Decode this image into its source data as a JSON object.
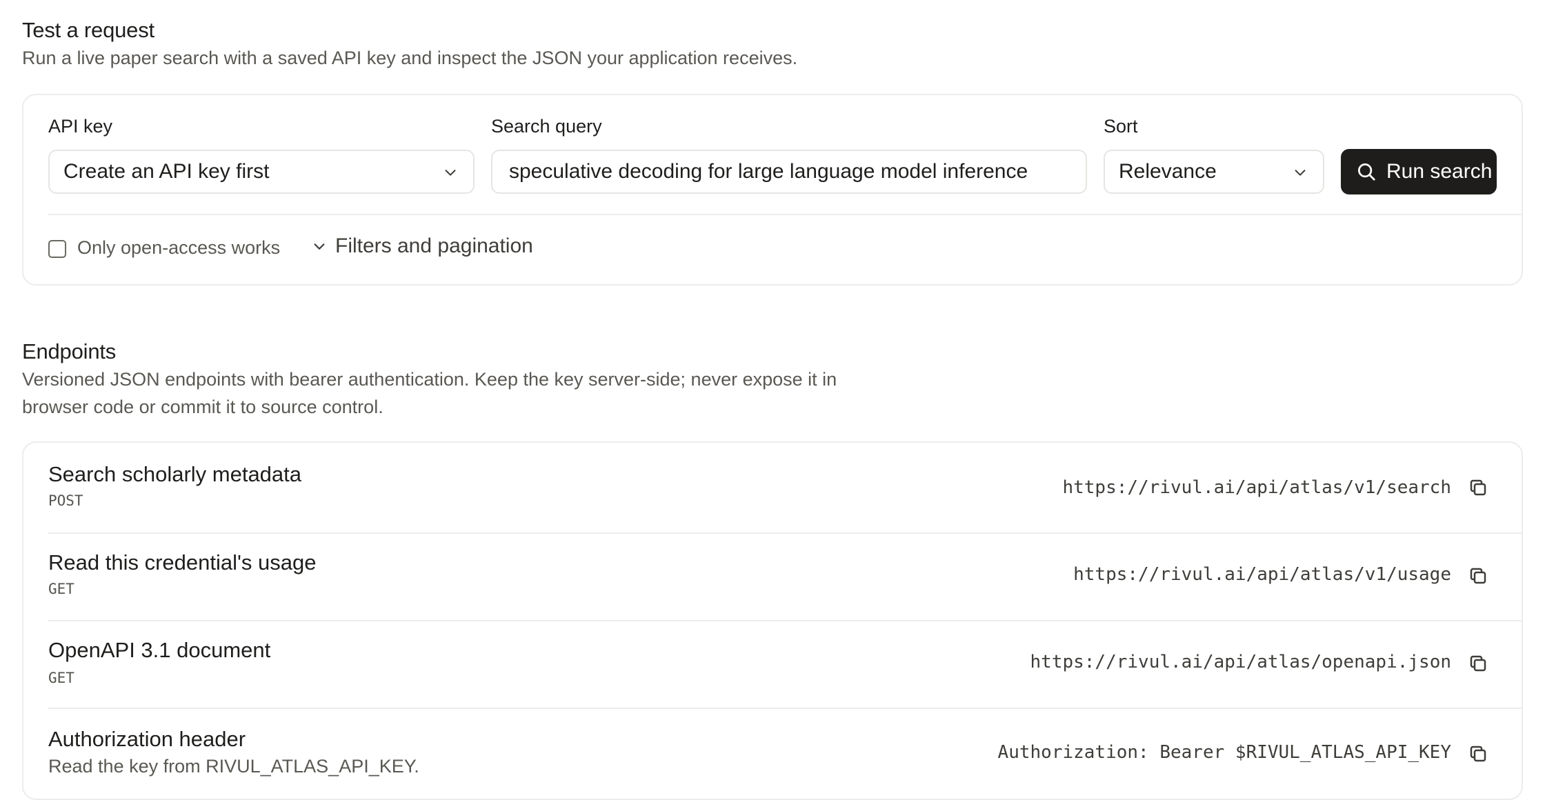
{
  "test_section": {
    "title": "Test a request",
    "description": "Run a live paper search with a saved API key and inspect the JSON your application receives.",
    "api_key_label": "API key",
    "api_key_value": "Create an API key first",
    "query_label": "Search query",
    "query_value": "speculative decoding for large language model inference",
    "sort_label": "Sort",
    "sort_value": "Relevance",
    "run_button": "Run search",
    "open_access_label": "Only open-access works",
    "open_access_checked": false,
    "filters_label": "Filters and pagination"
  },
  "endpoints_section": {
    "title": "Endpoints",
    "description_line1": "Versioned JSON endpoints with bearer authentication. Keep the key server-side; never expose it in",
    "description_line2": "browser code or commit it to source control.",
    "items": [
      {
        "title": "Search scholarly metadata",
        "method": "POST",
        "url": "https://rivul.ai/api/atlas/v1/search"
      },
      {
        "title": "Read this credential's usage",
        "method": "GET",
        "url": "https://rivul.ai/api/atlas/v1/usage"
      },
      {
        "title": "OpenAPI 3.1 document",
        "method": "GET",
        "url": "https://rivul.ai/api/atlas/openapi.json"
      },
      {
        "title": "Authorization header",
        "subtitle": "Read the key from RIVUL_ATLAS_API_KEY.",
        "url": "Authorization: Bearer $RIVUL_ATLAS_API_KEY"
      }
    ]
  },
  "icons": {
    "dropdown": "chevron-down-icon",
    "search": "search-icon",
    "copy": "copy-icon"
  },
  "colors": {
    "primary_button": "#1e1d1b",
    "border": "#ececea",
    "muted_text": "#5a5853"
  }
}
